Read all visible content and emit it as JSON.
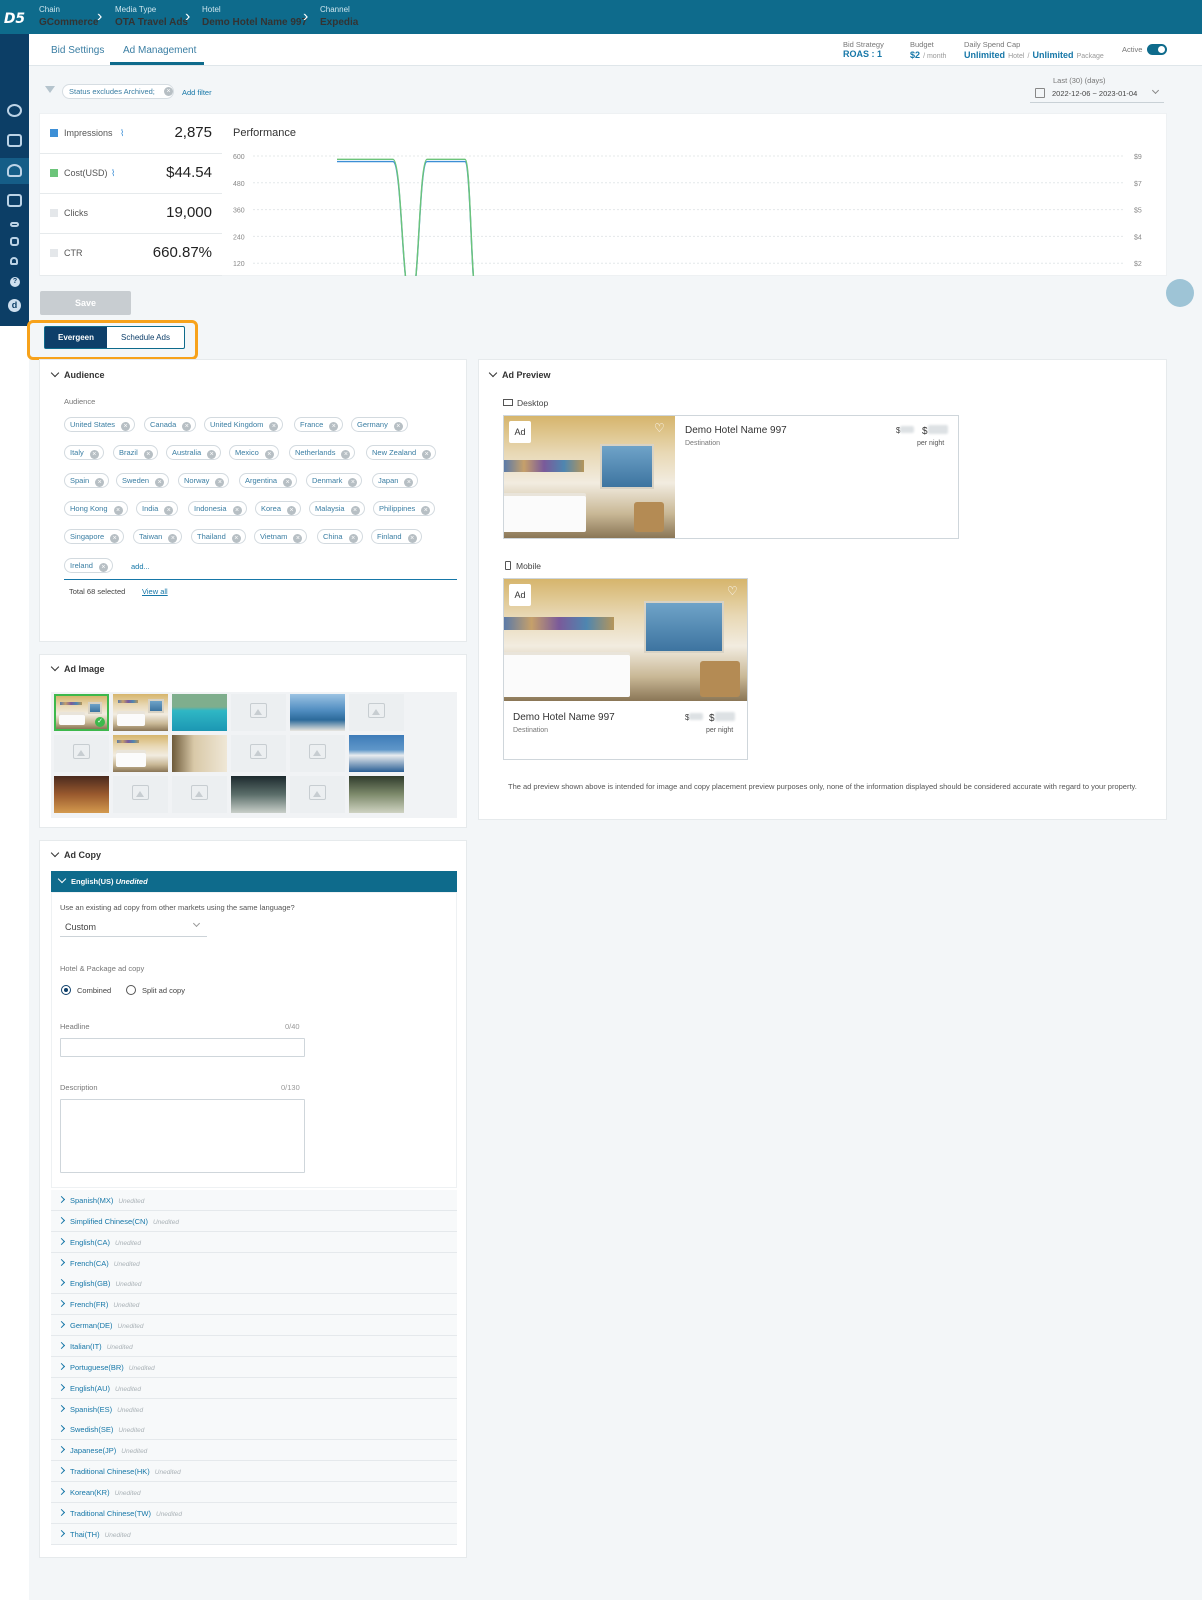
{
  "breadcrumb": [
    {
      "label": "Chain",
      "value": "GCommerce"
    },
    {
      "label": "Media Type",
      "value": "OTA Travel Ads"
    },
    {
      "label": "Hotel",
      "value": "Demo Hotel Name 997"
    },
    {
      "label": "Channel",
      "value": "Expedia"
    }
  ],
  "logo": "D5",
  "tabs": {
    "bid_settings": "Bid Settings",
    "ad_management": "Ad Management"
  },
  "header_stats": {
    "bid_strategy_label": "Bid Strategy",
    "bid_strategy_value": "ROAS : 1",
    "budget_label": "Budget",
    "budget_value": "$2",
    "budget_unit": "/ month",
    "spend_cap_label": "Daily Spend Cap",
    "spend_cap_hotel": "Unlimited",
    "spend_cap_hotel_sub": "Hotel",
    "spend_cap_sep": "/",
    "spend_cap_package": "Unlimited",
    "spend_cap_package_sub": "Package",
    "active_label": "Active"
  },
  "filter": {
    "chip": "Status excludes Archived;",
    "add": "Add filter"
  },
  "date_range": {
    "label": "Last (30) (days)",
    "value": "2022-12-06 ~ 2023-01-04"
  },
  "metrics": [
    {
      "name": "Impressions",
      "value": "2,875",
      "color": "#3d8fd6"
    },
    {
      "name": "Cost(USD)",
      "value": "$44.54",
      "color": "#6cc47a"
    },
    {
      "name": "Clicks",
      "value": "19,000",
      "color": "#e4e7ea"
    },
    {
      "name": "CTR",
      "value": "660.87%",
      "color": "#e4e7ea"
    }
  ],
  "chart_data": {
    "type": "line",
    "title": "Performance",
    "ylim": [
      0,
      600
    ],
    "y_ticks_left": [
      "600",
      "480",
      "360",
      "240",
      "120"
    ],
    "y_ticks_right": [
      "$9",
      "$7",
      "$5",
      "$4",
      "$2"
    ],
    "series": [
      {
        "name": "Impressions",
        "color": "#3d8fd6",
        "values": [
          575,
          575,
          575,
          0,
          575,
          575,
          0
        ]
      },
      {
        "name": "Cost(USD)",
        "color": "#6cc47a",
        "values": [
          585,
          585,
          585,
          0,
          585,
          585,
          0
        ]
      }
    ]
  },
  "save_label": "Save",
  "segment": {
    "evergreen": "Evergeen",
    "schedule": "Schedule Ads"
  },
  "audience": {
    "title": "Audience",
    "field_label": "Audience",
    "countries": [
      "United States",
      "Canada",
      "United Kingdom",
      "France",
      "Germany",
      "Italy",
      "Brazil",
      "Australia",
      "Mexico",
      "Netherlands",
      "New Zealand",
      "Spain",
      "Sweden",
      "Norway",
      "Argentina",
      "Denmark",
      "Japan",
      "Hong Kong",
      "India",
      "Indonesia",
      "Korea",
      "Malaysia",
      "Philippines",
      "Singapore",
      "Taiwan",
      "Thailand",
      "Vietnam",
      "China",
      "Finland",
      "Ireland"
    ],
    "add": "add...",
    "total": "Total 68 selected",
    "view_all": "View all"
  },
  "ad_image": {
    "title": "Ad Image"
  },
  "ad_copy": {
    "title": "Ad Copy",
    "open_lang": "English(US)",
    "open_status": "Unedited",
    "question": "Use an existing ad copy from other markets using the same language?",
    "select_value": "Custom",
    "copy_type_label": "Hotel & Package ad copy",
    "radio_combined": "Combined",
    "radio_split": "Split ad copy",
    "headline_label": "Headline",
    "headline_count": "0/40",
    "description_label": "Description",
    "description_count": "0/130",
    "languages": [
      "Spanish(MX)",
      "Simplified Chinese(CN)",
      "English(CA)",
      "French(CA)",
      "English(GB)",
      "French(FR)",
      "German(DE)",
      "Italian(IT)",
      "Portuguese(BR)",
      "English(AU)",
      "Spanish(ES)",
      "Swedish(SE)",
      "Japanese(JP)",
      "Traditional Chinese(HK)",
      "Korean(KR)",
      "Traditional Chinese(TW)",
      "Thai(TH)"
    ],
    "lang_status": "Unedited"
  },
  "ad_preview": {
    "title": "Ad Preview",
    "desktop": "Desktop",
    "mobile": "Mobile",
    "badge": "Ad",
    "hotel_name": "Demo Hotel Name 997",
    "destination": "Destination",
    "currency": "$",
    "per_night": "per night",
    "disclaimer": "The ad preview shown above is intended for image and copy placement preview purposes only, none of the information displayed should be considered accurate with regard to your property."
  }
}
